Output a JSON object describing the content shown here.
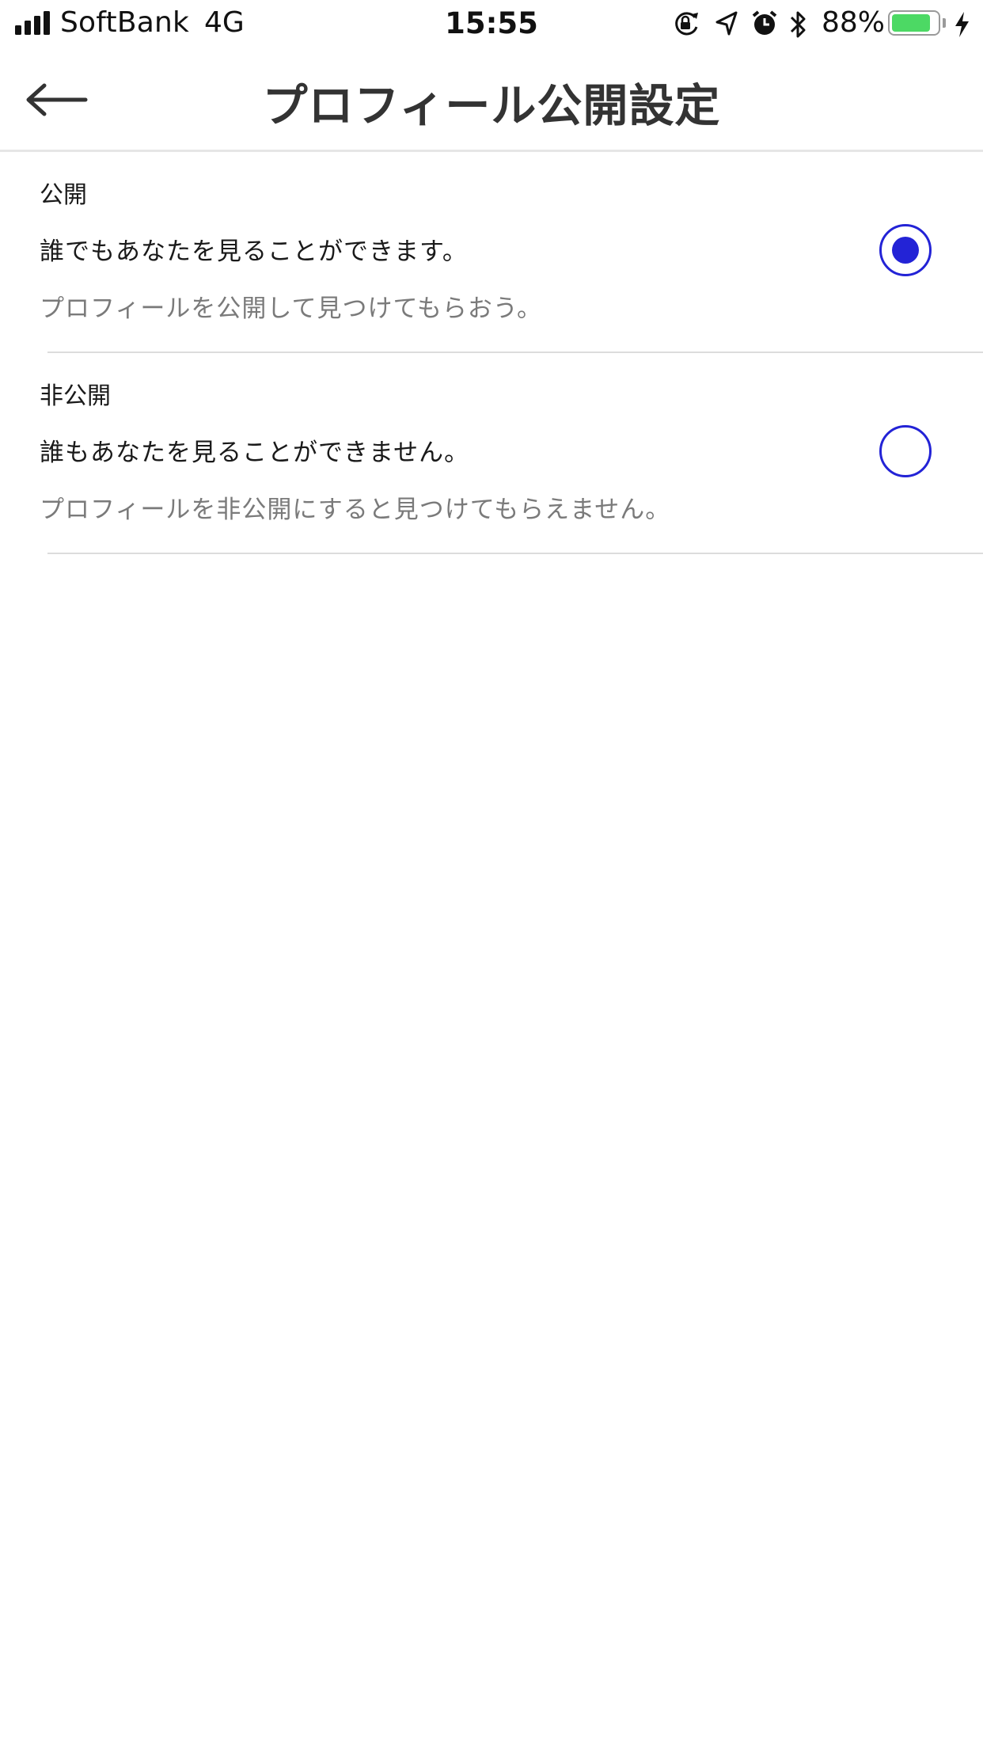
{
  "status_bar": {
    "carrier": "SoftBank",
    "network": "4G",
    "time": "15:55",
    "battery_percent": "88%",
    "battery_level": 0.88,
    "icons": [
      "signal-icon",
      "orientation-lock-icon",
      "location-icon",
      "alarm-icon",
      "bluetooth-icon",
      "battery-icon",
      "charging-icon"
    ]
  },
  "nav": {
    "title": "プロフィール公開設定",
    "back_icon": "back-arrow-icon"
  },
  "options": [
    {
      "title": "公開",
      "description": "誰でもあなたを見ることができます。",
      "sub": "プロフィールを公開して見つけてもらおう。",
      "selected": true
    },
    {
      "title": "非公開",
      "description": "誰もあなたを見ることができません。",
      "sub": "プロフィールを非公開にすると見つけてもらえません。",
      "selected": false
    }
  ],
  "colors": {
    "accent": "#2323d6",
    "title_text": "#333333",
    "secondary_text": "#7a7a7a",
    "battery_fill": "#4cd964"
  }
}
